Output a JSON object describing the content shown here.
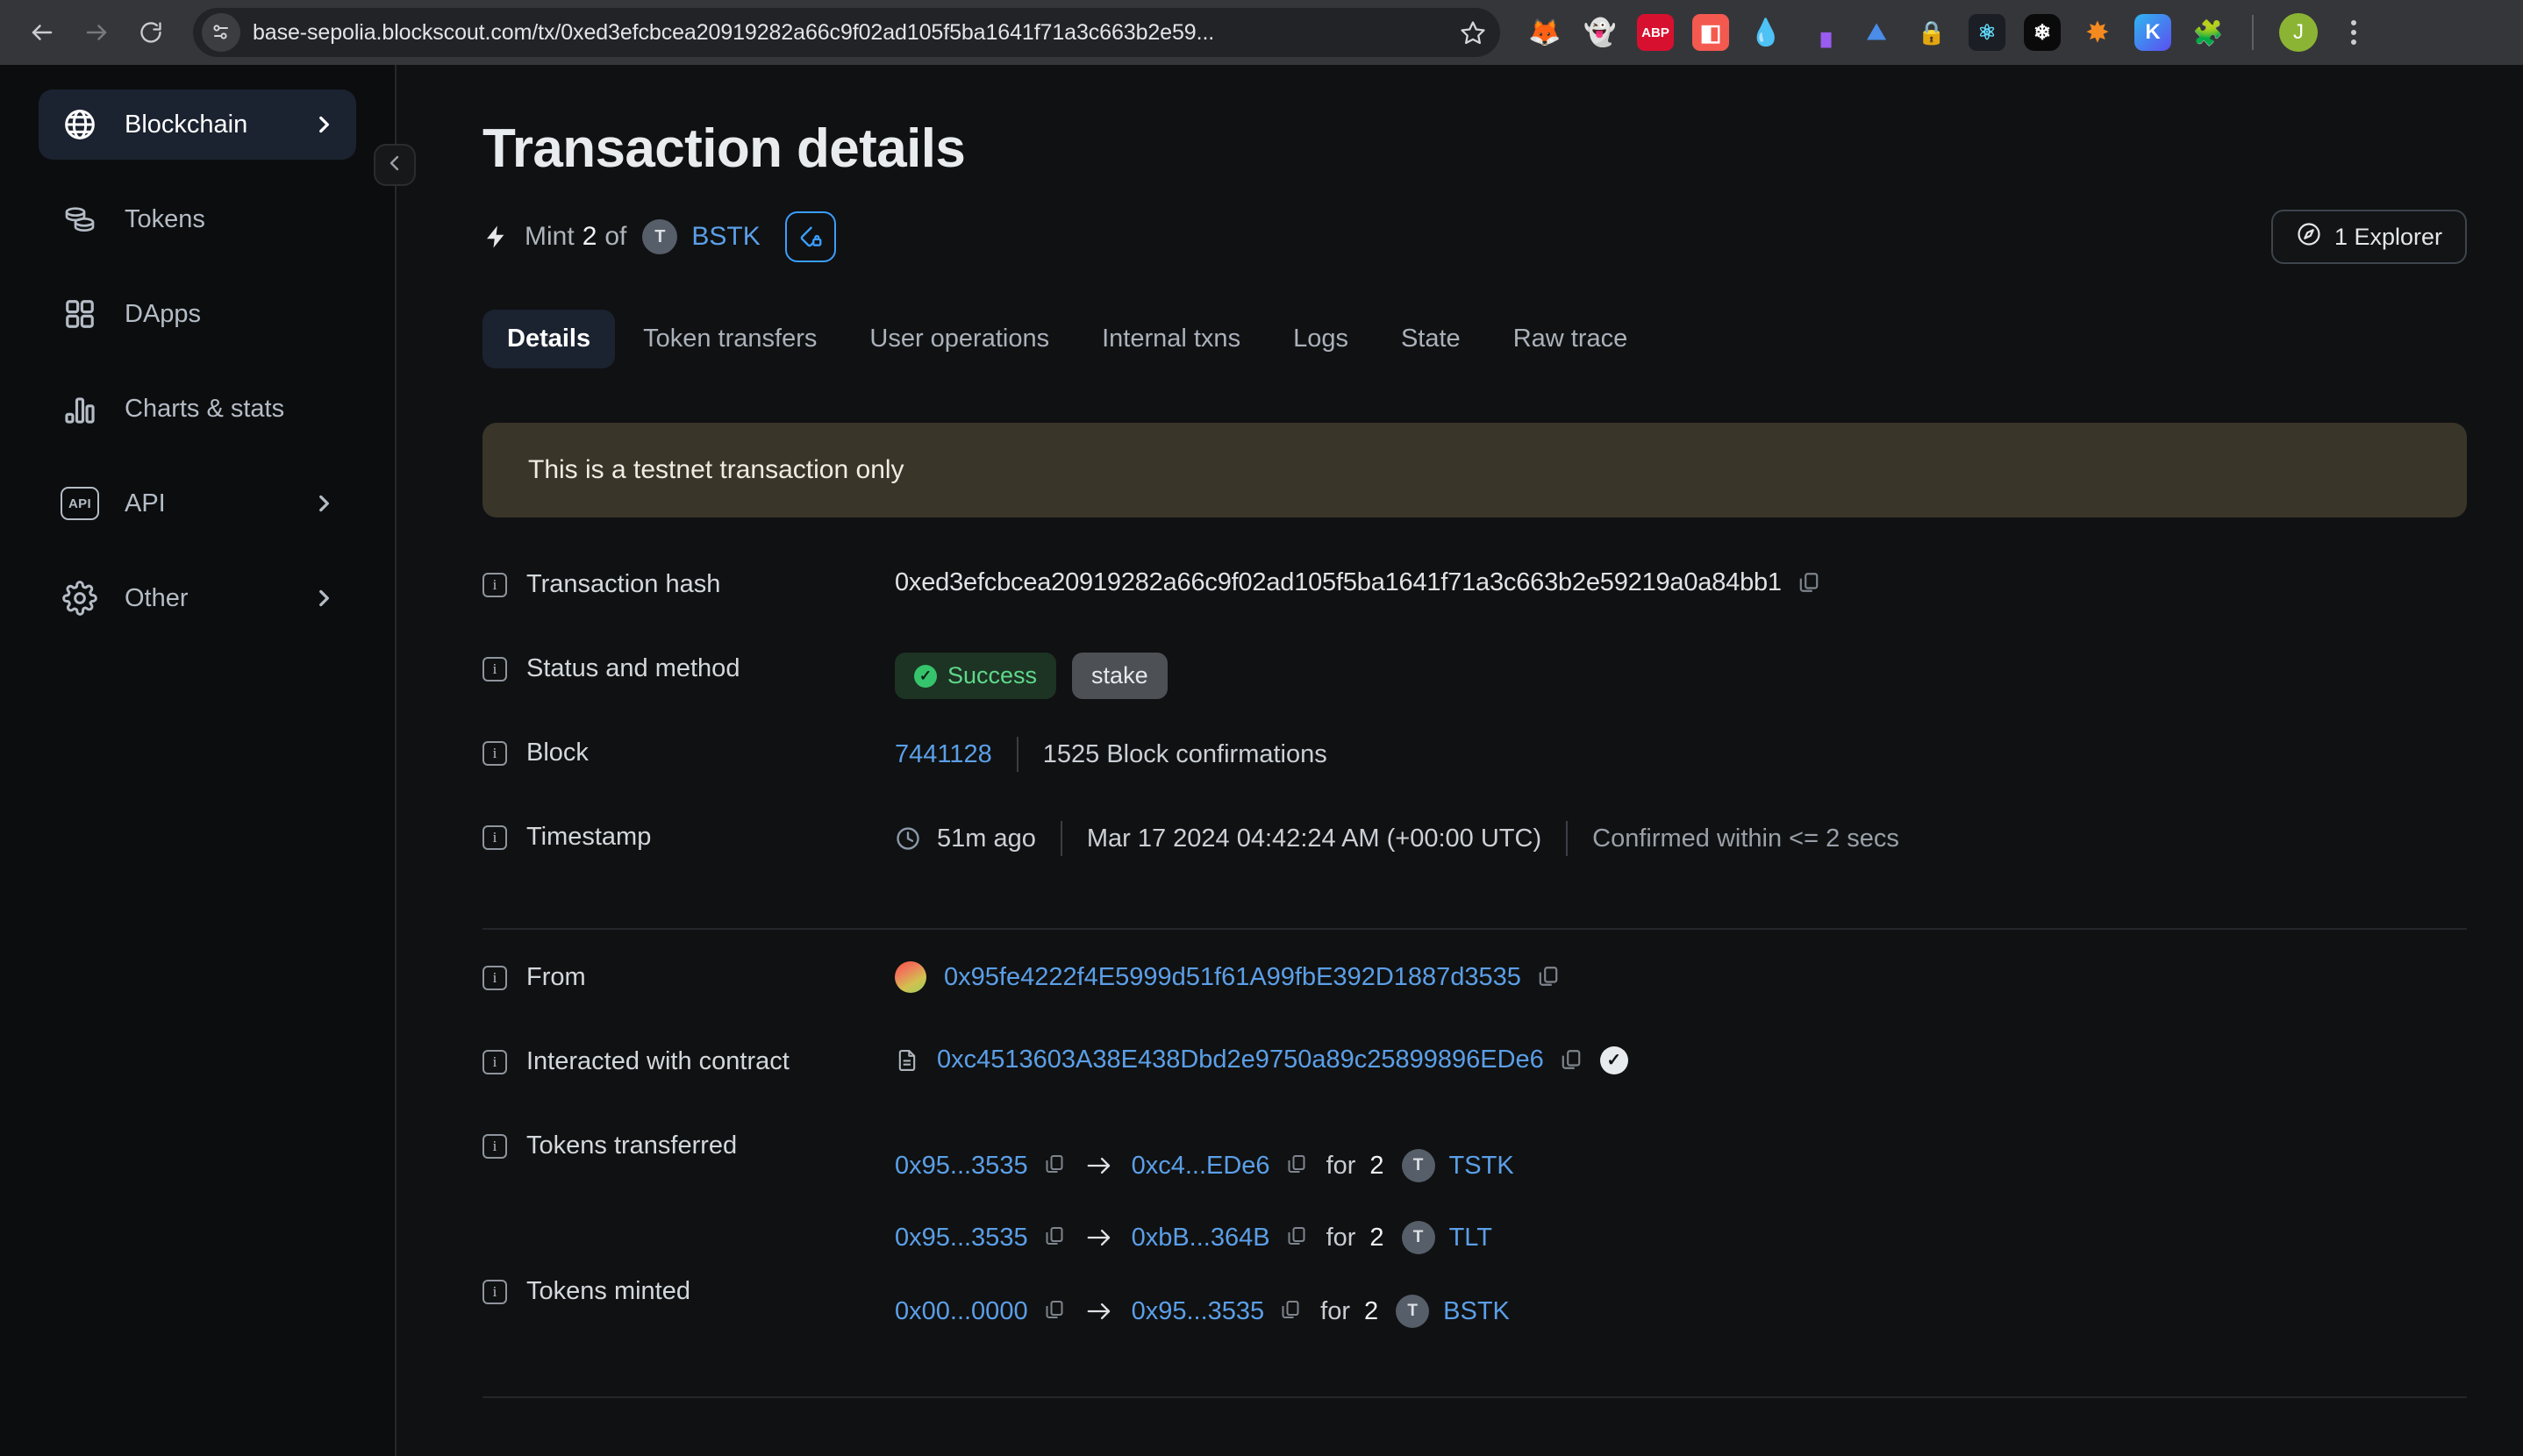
{
  "browser": {
    "url": "base-sepolia.blockscout.com/tx/0xed3efcbcea20919282a66c9f02ad105f5ba1641f71a3c663b2e59...",
    "back_icon": "back-arrow-icon",
    "forward_icon": "forward-arrow-icon",
    "reload_icon": "reload-icon",
    "site_info_icon": "site-settings-icon",
    "bookmark_icon": "star-icon",
    "profile_initial": "J",
    "extensions": [
      {
        "name": "metamask-extension",
        "glyph": "🦊",
        "bg": "transparent",
        "color": "#e8820c"
      },
      {
        "name": "ghostery-extension",
        "glyph": "👻",
        "bg": "transparent",
        "color": "#b9aaf5"
      },
      {
        "name": "adblock-plus-extension",
        "glyph": "ABP",
        "bg": "#d8102f",
        "color": "#ffffff"
      },
      {
        "name": "pocket-extension",
        "glyph": "▐",
        "bg": "#f4594f",
        "color": "#ffffff"
      },
      {
        "name": "rainbow-wallet-extension",
        "glyph": "💧",
        "bg": "transparent",
        "color": "#49a8d8"
      },
      {
        "name": "phantom-wallet-extension",
        "glyph": "◧",
        "bg": "transparent",
        "color": "#9b5cf0"
      },
      {
        "name": "nordvpn-extension",
        "glyph": "⛰",
        "bg": "transparent",
        "color": "#4a8ce8"
      },
      {
        "name": "bitwarden-extension",
        "glyph": "🔒",
        "bg": "transparent",
        "color": "#e8414a"
      },
      {
        "name": "react-devtools-extension",
        "glyph": "⚛",
        "bg": "#1b1e24",
        "color": "#61dafb"
      },
      {
        "name": "snowflake-extension",
        "glyph": "❄",
        "bg": "#0a0a0a",
        "color": "#ffffff"
      },
      {
        "name": "sparkle-extension",
        "glyph": "✸",
        "bg": "transparent",
        "color": "#f58a1f"
      },
      {
        "name": "keplr-wallet-extension",
        "glyph": "K",
        "bg": "#2b7de8",
        "color": "#ffffff"
      },
      {
        "name": "extensions-puzzle-icon",
        "glyph": "🧩",
        "bg": "transparent",
        "color": "#c9ccd0"
      }
    ]
  },
  "sidebar": {
    "collapse_icon": "chevron-left-icon",
    "items": [
      {
        "label": "Blockchain",
        "icon": "globe-icon",
        "active": true,
        "has_chevron": true
      },
      {
        "label": "Tokens",
        "icon": "coins-icon",
        "active": false,
        "has_chevron": false
      },
      {
        "label": "DApps",
        "icon": "grid-icon",
        "active": false,
        "has_chevron": false
      },
      {
        "label": "Charts & stats",
        "icon": "bar-chart-icon",
        "active": false,
        "has_chevron": false
      },
      {
        "label": "API",
        "icon": "api-icon",
        "active": false,
        "has_chevron": true
      },
      {
        "label": "Other",
        "icon": "gear-icon",
        "active": false,
        "has_chevron": true
      }
    ]
  },
  "main": {
    "title": "Transaction details",
    "subhead": {
      "bolt_icon": "lightning-bolt-icon",
      "action": "Mint",
      "amount": "2",
      "of": "of",
      "token_avatar": "T",
      "token_symbol": "BSTK",
      "lock_badge_icon": "token-lock-icon"
    },
    "explorer_button": {
      "icon": "compass-icon",
      "label": "1 Explorer"
    },
    "tabs": [
      {
        "label": "Details",
        "active": true
      },
      {
        "label": "Token transfers",
        "active": false
      },
      {
        "label": "User operations",
        "active": false
      },
      {
        "label": "Internal txns",
        "active": false
      },
      {
        "label": "Logs",
        "active": false
      },
      {
        "label": "State",
        "active": false
      },
      {
        "label": "Raw trace",
        "active": false
      }
    ],
    "banner": "This is a testnet transaction only",
    "details": {
      "transaction_hash": {
        "label": "Transaction hash",
        "value": "0xed3efcbcea20919282a66c9f02ad105f5ba1641f71a3c663b2e59219a0a84bb1",
        "copy_icon": "copy-icon"
      },
      "status_and_method": {
        "label": "Status and method",
        "status": "Success",
        "method": "stake"
      },
      "block": {
        "label": "Block",
        "number": "7441128",
        "confirmations": "1525 Block confirmations"
      },
      "timestamp": {
        "label": "Timestamp",
        "relative": "51m ago",
        "absolute": "Mar 17 2024 04:42:24 AM (+00:00 UTC)",
        "confirmed": "Confirmed within <= 2 secs"
      },
      "from": {
        "label": "From",
        "address": "0x95fe4222f4E5999d51f61A99fbE392D1887d3535"
      },
      "interacted_with_contract": {
        "label": "Interacted with contract",
        "address": "0xc4513603A38E438Dbd2e9750a89c25899896EDe6"
      },
      "tokens_transferred": {
        "label": "Tokens transferred",
        "rows": [
          {
            "from": "0x95...3535",
            "to": "0xc4...EDe6",
            "for": "for",
            "amount": "2",
            "avatar": "T",
            "symbol": "TSTK"
          },
          {
            "from": "0x95...3535",
            "to": "0xbB...364B",
            "for": "for",
            "amount": "2",
            "avatar": "T",
            "symbol": "TLT"
          }
        ]
      },
      "tokens_minted": {
        "label": "Tokens minted",
        "rows": [
          {
            "from": "0x00...0000",
            "to": "0x95...3535",
            "for": "for",
            "amount": "2",
            "avatar": "T",
            "symbol": "BSTK"
          }
        ]
      }
    }
  },
  "colors": {
    "accent_link": "#5b9fe8",
    "success": "#5ed98a",
    "banner_bg": "#3a3529",
    "active_nav_bg": "#1b2230"
  }
}
